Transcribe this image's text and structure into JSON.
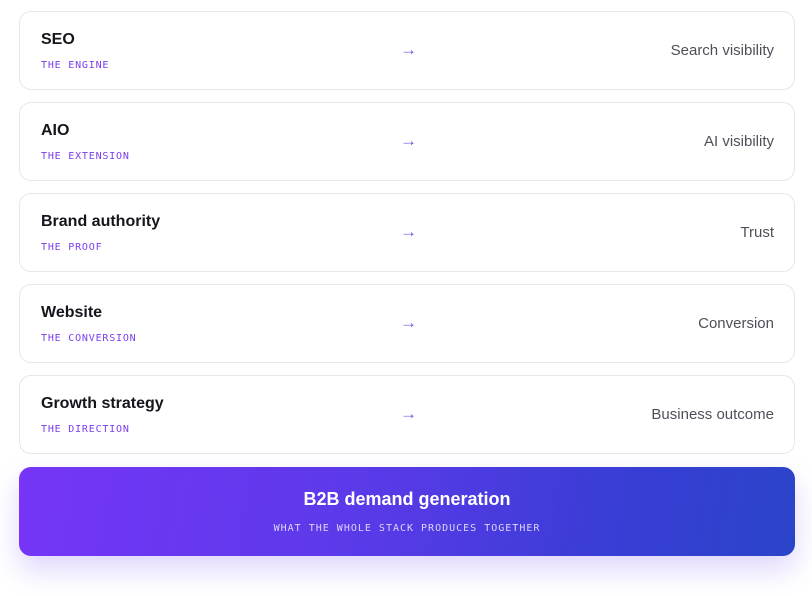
{
  "rows": [
    {
      "title": "SEO",
      "tag": "THE ENGINE",
      "arrow": "→",
      "outcome": "Search visibility"
    },
    {
      "title": "AIO",
      "tag": "THE EXTENSION",
      "arrow": "→",
      "outcome": "AI visibility"
    },
    {
      "title": "Brand authority",
      "tag": "THE PROOF",
      "arrow": "→",
      "outcome": "Trust"
    },
    {
      "title": "Website",
      "tag": "THE CONVERSION",
      "arrow": "→",
      "outcome": "Conversion"
    },
    {
      "title": "Growth strategy",
      "tag": "THE DIRECTION",
      "arrow": "→",
      "outcome": "Business outcome"
    }
  ],
  "result": {
    "title": "B2B demand generation",
    "subtitle": "WHAT THE WHOLE STACK PRODUCES TOGETHER"
  },
  "colors": {
    "accent": "#7a3df0",
    "gradient_start": "#7635f7",
    "gradient_end": "#2a44c9"
  }
}
